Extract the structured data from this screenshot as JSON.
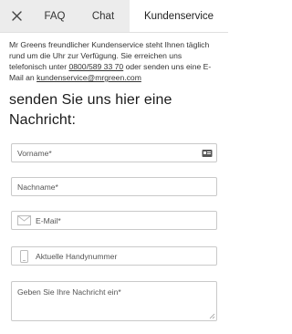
{
  "header": {
    "close_icon": "close-icon",
    "tabs": [
      {
        "label": "FAQ",
        "active": false
      },
      {
        "label": "Chat",
        "active": false
      },
      {
        "label": "Kundenservice",
        "active": true
      }
    ]
  },
  "intro": {
    "text_1": "Mr Greens freundlicher Kundenservice steht Ihnen täglich rund um die Uhr zur Verfügung. Sie erreichen uns telefonisch unter ",
    "phone": "0800/589 33 70",
    "text_2": " oder senden uns eine E-Mail an ",
    "email": "kundenservice@mrgreen.com"
  },
  "form": {
    "heading": "senden Sie uns hier eine Nachricht:",
    "firstname_placeholder": "Vorname*",
    "lastname_placeholder": "Nachname*",
    "email_placeholder": "E-Mail*",
    "phone_placeholder": "Aktuelle Handynummer",
    "message_placeholder": "Geben Sie Ihre Nachricht ein*"
  },
  "colors": {
    "header_bg": "#ececec",
    "border": "#c9c9c9",
    "text": "#222222"
  }
}
